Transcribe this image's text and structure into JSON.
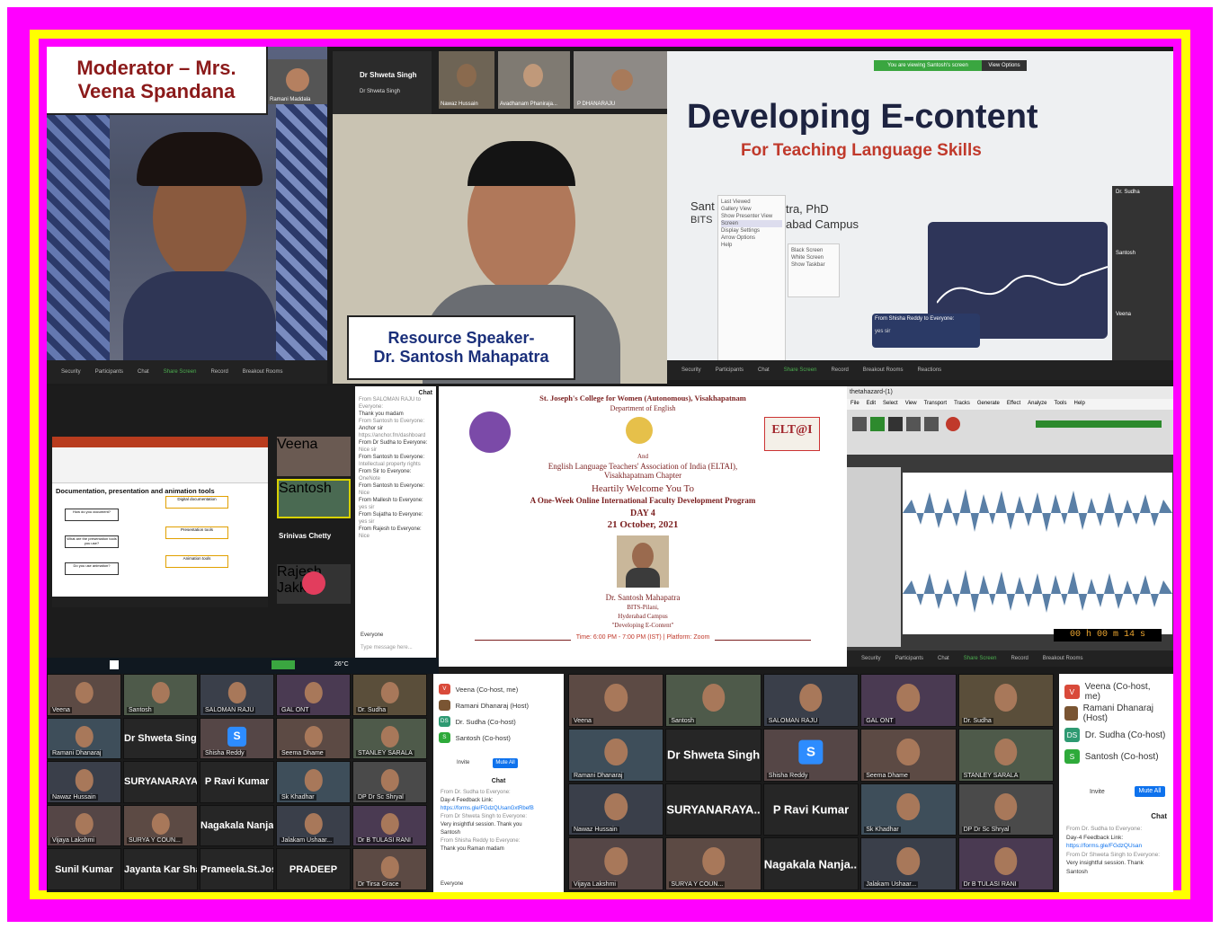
{
  "moderator": {
    "line1": "Moderator – Mrs.",
    "line2": "Veena Spandana",
    "tile_name": "Ramani Maddala"
  },
  "speaker": {
    "line1": "Resource Speaker-",
    "line2": "Dr. Santosh Mahapatra"
  },
  "video2": {
    "top_name": "Dr Shweta Singh",
    "thumbs": [
      "Dr Shweta Singh",
      "Nawaz Hussain",
      "Avadhanam Phaniraja...",
      "P DHANARAJU"
    ]
  },
  "slide": {
    "banner": "You are viewing Santosh's screen",
    "view_options": "View Options",
    "title": "Developing E-content",
    "subtitle": "For Teaching Language Skills",
    "author_a": "Sant",
    "author_b": "BITS",
    "author_c": "tra, PhD",
    "author_d": "abad Campus",
    "menu": [
      "Last Viewed",
      "Gallery View",
      "Show Presenter View",
      "Screen",
      "Display Settings",
      "Arrow Options",
      "Help"
    ],
    "submenu": [
      "Black Screen",
      "White Screen",
      "Show Taskbar"
    ],
    "chat_from": "From Shisha Reddy to Everyone:",
    "chat_msg": "yes sir",
    "side": [
      "Dr. Sudha",
      "Santosh",
      "Veena"
    ]
  },
  "ppt": {
    "heading": "Documentation, presentation and animation tools",
    "q": [
      "How do you document?",
      "What are the presentation tools you use?",
      "Do you use animation?"
    ],
    "a": [
      "Digital documentation",
      "Presentation tools",
      "Animation tools"
    ],
    "gallery": [
      "Veena",
      "Santosh",
      "Srinivas Chetty",
      "Rajesh Jakkul"
    ]
  },
  "chatpanel": {
    "title": "Chat",
    "lines": [
      "From SALOMAN RAJU to Everyone:",
      "Thank you madam",
      "From Santosh to Everyone:",
      "Anchor sir",
      "https://anchor.fm/dashboard",
      "From Dr Sudha to Everyone:",
      "Nice sir",
      "From Santosh to Everyone:",
      "Intellectual property rights",
      "From Sir to Everyone:",
      "OneNote",
      "From Santosh to Everyone:",
      "Nice",
      "From Mallesh to Everyone:",
      "yes sir",
      "From Sujatha to Everyone:",
      "yes sir",
      "From Rajesh to Everyone:",
      "Nice"
    ],
    "to": "Everyone",
    "placeholder": "Type message here..."
  },
  "poster": {
    "college": "St. Joseph's College for Women (Autonomous), Visakhapatnam",
    "dept": "Department of English",
    "and": "And",
    "eltai": "English Language Teachers' Association of India (ELTAI),",
    "chapter": "Visakhapatnam Chapter",
    "welcome": "Heartily Welcome You To",
    "program": "A One-Week Online International Faculty Development Program",
    "day": "DAY 4",
    "date": "21 October, 2021",
    "name": "Dr. Santosh Mahapatra",
    "inst": "BITS-Pilani,",
    "campus": "Hyderabad Campus",
    "topic": "\"Developing E-Content\"",
    "time": "Time: 6:00 PM - 7:00 PM (IST) | Platform: Zoom",
    "eltai_logo": "ELT@I"
  },
  "audacity": {
    "title": "thetahazard-(1)",
    "menus": [
      "File",
      "Edit",
      "Select",
      "View",
      "Transport",
      "Tracks",
      "Generate",
      "Effect",
      "Analyze",
      "Tools",
      "Help"
    ],
    "counter": "00 h 00 m 14 s"
  },
  "taskbar": {
    "weather": "26°C"
  },
  "gallery_left": [
    [
      "Veena",
      "Santosh",
      "SALOMAN RAJU",
      "GAL ONT",
      "Dr. Sudha"
    ],
    [
      "Ramani Dhanaraj",
      "Dr Shweta Singh",
      "Shisha Reddy",
      "Seema Dhame",
      "STANLEY SARALA"
    ],
    [
      "Nawaz Hussain",
      "SURYANARAYA...",
      "P Ravi Kumar",
      "Sk Khadhar",
      "DP Dr Sc Shryal"
    ],
    [
      "Vijaya Lakshmi",
      "SURYA Y COUN...",
      "Nagakala Nanja...",
      "Jalakam Ushaar...",
      "Dr B TULASI RANI"
    ],
    [
      "Sunil Kumar",
      "Jayanta Kar Sha...",
      "Prameela.St.Jos...",
      "PRADEEP",
      "Dr Tirsa Grace"
    ]
  ],
  "participants_mid": [
    {
      "name": "Veena (Co-host, me)",
      "color": "#d94a3a",
      "init": "V"
    },
    {
      "name": "Ramani Dhanaraj (Host)",
      "color": "#7a5533",
      "init": ""
    },
    {
      "name": "Dr. Sudha (Co-host)",
      "color": "#2e9a72",
      "init": "DS"
    },
    {
      "name": "Santosh (Co-host)",
      "color": "#2eaa3a",
      "init": "S"
    }
  ],
  "mid_buttons": {
    "invite": "Invite",
    "mute": "Mute All"
  },
  "mid_chat": {
    "title": "Chat",
    "lines": [
      "From Dr. Sudha to Everyone:",
      "Day-4 Feedback Link:",
      "https://forms.gle/FGdzQUsanGxtRbefB",
      "From Dr Shweta Singh to Everyone:",
      "Very insightful session. Thank you",
      "Santosh",
      "From Shisha Reddy to Everyone:",
      "Thank you Raman madam"
    ],
    "to": "Everyone"
  },
  "gallery_right": [
    [
      "Veena",
      "Santosh",
      "SALOMAN RAJU",
      "GAL ONT",
      "Dr. Sudha"
    ],
    [
      "Ramani Dhanaraj",
      "Dr Shweta Singh",
      "Shisha Reddy",
      "Seema Dhame",
      "STANLEY SARALA"
    ],
    [
      "Nawaz Hussain",
      "SURYANARAYA...",
      "P Ravi Kumar",
      "Sk Khadhar",
      "DP Dr Sc Shryal"
    ],
    [
      "Vijaya Lakshmi",
      "SURYA Y COUN...",
      "Nagakala Nanja...",
      "Jalakam Ushaar...",
      "Dr B TULASI RANI"
    ]
  ],
  "participants_right": [
    {
      "name": "Veena (Co-host, me)",
      "color": "#d94a3a",
      "init": "V"
    },
    {
      "name": "Ramani Dhanaraj (Host)",
      "color": "#7a5533",
      "init": ""
    },
    {
      "name": "Dr. Sudha (Co-host)",
      "color": "#2e9a72",
      "init": "DS"
    },
    {
      "name": "Santosh (Co-host)",
      "color": "#2eaa3a",
      "init": "S"
    }
  ],
  "right_buttons": {
    "invite": "Invite",
    "mute": "Mute All"
  },
  "right_chat": {
    "title": "Chat",
    "lines": [
      "From Dr. Sudha to Everyone:",
      "Day-4 Feedback Link:",
      "https://forms.gle/FGdzQUsan",
      "From Dr Shweta Singh to Everyone:",
      "Very insightful session. Thank",
      "Santosh"
    ]
  },
  "zoom_controls": [
    "Security",
    "Participants",
    "Chat",
    "Share Screen",
    "Record",
    "Breakout Rooms",
    "Reactions"
  ],
  "colors": {
    "magenta": "#ff00ff",
    "yellow": "#ffff00",
    "label_text": "#8b1a1a",
    "speaker_text": "#1a2f7a",
    "slide_title": "#1d2340",
    "slide_sub": "#c0392b"
  }
}
